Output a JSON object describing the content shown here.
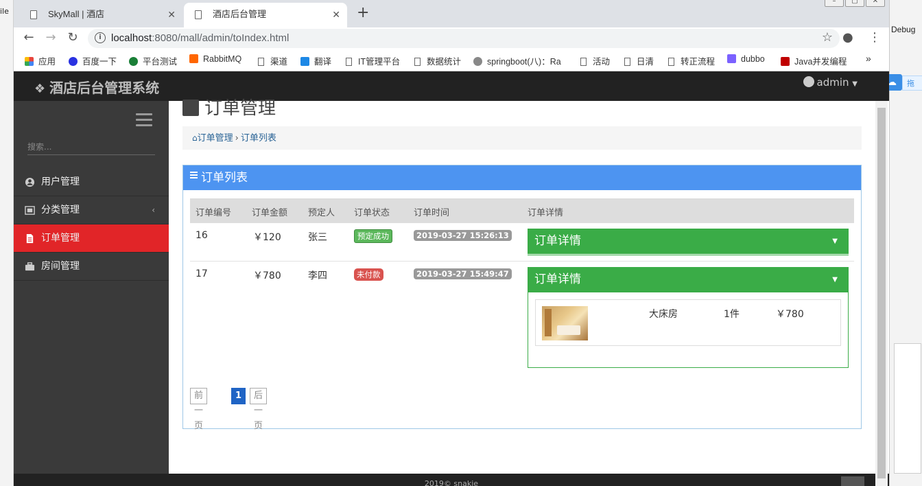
{
  "ide": {
    "left_label": "ile",
    "right_label": "Debug",
    "drag_label": "拖"
  },
  "browser": {
    "tabs": [
      {
        "title": "SkyMall | 酒店"
      },
      {
        "title": "酒店后台管理"
      }
    ],
    "url_host": "localhost",
    "url_rest": ":8080/mall/admin/toIndex.html",
    "bookmarks": [
      {
        "label": "应用",
        "color": "#e8453c"
      },
      {
        "label": "百度一下",
        "color": "#2932e1"
      },
      {
        "label": "平台测试",
        "color": "#1a7f37"
      },
      {
        "label": "RabbitMQ",
        "color": "#ff6600"
      },
      {
        "label": "渠道",
        "color": ""
      },
      {
        "label": "翻译",
        "color": "#1e88e5"
      },
      {
        "label": "IT管理平台",
        "color": ""
      },
      {
        "label": "数据统计",
        "color": ""
      },
      {
        "label": "springboot(八)：Ra",
        "color": "#888888"
      },
      {
        "label": "活动",
        "color": ""
      },
      {
        "label": "日清",
        "color": ""
      },
      {
        "label": "转正流程",
        "color": ""
      },
      {
        "label": "dubbo",
        "color": "#7b61ff"
      },
      {
        "label": "Java并发编程",
        "color": "#c00000"
      }
    ],
    "more": "»"
  },
  "app": {
    "brand": "酒店后台管理系统",
    "user": "admin",
    "search_placeholder": "搜索...",
    "menu": [
      {
        "label": "用户管理",
        "icon": "user-circle-icon"
      },
      {
        "label": "分类管理",
        "icon": "category-icon",
        "chevron": "‹"
      },
      {
        "label": "订单管理",
        "icon": "file-icon",
        "active": true
      },
      {
        "label": "房间管理",
        "icon": "suitcase-icon"
      }
    ],
    "page_title": "订单管理",
    "breadcrumb": {
      "home": "订单管理",
      "current": "订单列表"
    },
    "panel_title": "订单列表",
    "table": {
      "headers": [
        "订单编号",
        "订单金额",
        "预定人",
        "订单状态",
        "订单时间",
        "订单详情"
      ],
      "rows": [
        {
          "id": "16",
          "amount": "￥120",
          "customer": "张三",
          "status": "预定成功",
          "time": "2019-03-27 15:26:13",
          "detail": "订单详情"
        },
        {
          "id": "17",
          "amount": "￥780",
          "customer": "李四",
          "status": "未付款",
          "time": "2019-03-27 15:49:47",
          "detail": "订单详情",
          "item": {
            "room": "大床房",
            "qty": "1件",
            "price": "￥780"
          }
        }
      ]
    },
    "pager": {
      "prev": "前一页",
      "current": "1",
      "next": "后一页"
    },
    "footer": "2019© snakie"
  }
}
